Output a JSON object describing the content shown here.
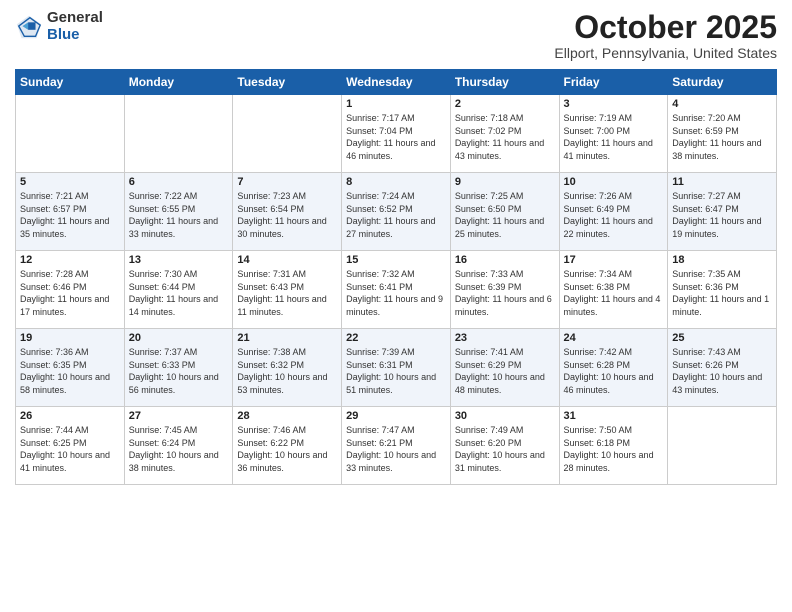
{
  "header": {
    "logo_general": "General",
    "logo_blue": "Blue",
    "month_title": "October 2025",
    "location": "Ellport, Pennsylvania, United States"
  },
  "days_of_week": [
    "Sunday",
    "Monday",
    "Tuesday",
    "Wednesday",
    "Thursday",
    "Friday",
    "Saturday"
  ],
  "weeks": [
    [
      {
        "day": "",
        "info": ""
      },
      {
        "day": "",
        "info": ""
      },
      {
        "day": "",
        "info": ""
      },
      {
        "day": "1",
        "info": "Sunrise: 7:17 AM\nSunset: 7:04 PM\nDaylight: 11 hours and 46 minutes."
      },
      {
        "day": "2",
        "info": "Sunrise: 7:18 AM\nSunset: 7:02 PM\nDaylight: 11 hours and 43 minutes."
      },
      {
        "day": "3",
        "info": "Sunrise: 7:19 AM\nSunset: 7:00 PM\nDaylight: 11 hours and 41 minutes."
      },
      {
        "day": "4",
        "info": "Sunrise: 7:20 AM\nSunset: 6:59 PM\nDaylight: 11 hours and 38 minutes."
      }
    ],
    [
      {
        "day": "5",
        "info": "Sunrise: 7:21 AM\nSunset: 6:57 PM\nDaylight: 11 hours and 35 minutes."
      },
      {
        "day": "6",
        "info": "Sunrise: 7:22 AM\nSunset: 6:55 PM\nDaylight: 11 hours and 33 minutes."
      },
      {
        "day": "7",
        "info": "Sunrise: 7:23 AM\nSunset: 6:54 PM\nDaylight: 11 hours and 30 minutes."
      },
      {
        "day": "8",
        "info": "Sunrise: 7:24 AM\nSunset: 6:52 PM\nDaylight: 11 hours and 27 minutes."
      },
      {
        "day": "9",
        "info": "Sunrise: 7:25 AM\nSunset: 6:50 PM\nDaylight: 11 hours and 25 minutes."
      },
      {
        "day": "10",
        "info": "Sunrise: 7:26 AM\nSunset: 6:49 PM\nDaylight: 11 hours and 22 minutes."
      },
      {
        "day": "11",
        "info": "Sunrise: 7:27 AM\nSunset: 6:47 PM\nDaylight: 11 hours and 19 minutes."
      }
    ],
    [
      {
        "day": "12",
        "info": "Sunrise: 7:28 AM\nSunset: 6:46 PM\nDaylight: 11 hours and 17 minutes."
      },
      {
        "day": "13",
        "info": "Sunrise: 7:30 AM\nSunset: 6:44 PM\nDaylight: 11 hours and 14 minutes."
      },
      {
        "day": "14",
        "info": "Sunrise: 7:31 AM\nSunset: 6:43 PM\nDaylight: 11 hours and 11 minutes."
      },
      {
        "day": "15",
        "info": "Sunrise: 7:32 AM\nSunset: 6:41 PM\nDaylight: 11 hours and 9 minutes."
      },
      {
        "day": "16",
        "info": "Sunrise: 7:33 AM\nSunset: 6:39 PM\nDaylight: 11 hours and 6 minutes."
      },
      {
        "day": "17",
        "info": "Sunrise: 7:34 AM\nSunset: 6:38 PM\nDaylight: 11 hours and 4 minutes."
      },
      {
        "day": "18",
        "info": "Sunrise: 7:35 AM\nSunset: 6:36 PM\nDaylight: 11 hours and 1 minute."
      }
    ],
    [
      {
        "day": "19",
        "info": "Sunrise: 7:36 AM\nSunset: 6:35 PM\nDaylight: 10 hours and 58 minutes."
      },
      {
        "day": "20",
        "info": "Sunrise: 7:37 AM\nSunset: 6:33 PM\nDaylight: 10 hours and 56 minutes."
      },
      {
        "day": "21",
        "info": "Sunrise: 7:38 AM\nSunset: 6:32 PM\nDaylight: 10 hours and 53 minutes."
      },
      {
        "day": "22",
        "info": "Sunrise: 7:39 AM\nSunset: 6:31 PM\nDaylight: 10 hours and 51 minutes."
      },
      {
        "day": "23",
        "info": "Sunrise: 7:41 AM\nSunset: 6:29 PM\nDaylight: 10 hours and 48 minutes."
      },
      {
        "day": "24",
        "info": "Sunrise: 7:42 AM\nSunset: 6:28 PM\nDaylight: 10 hours and 46 minutes."
      },
      {
        "day": "25",
        "info": "Sunrise: 7:43 AM\nSunset: 6:26 PM\nDaylight: 10 hours and 43 minutes."
      }
    ],
    [
      {
        "day": "26",
        "info": "Sunrise: 7:44 AM\nSunset: 6:25 PM\nDaylight: 10 hours and 41 minutes."
      },
      {
        "day": "27",
        "info": "Sunrise: 7:45 AM\nSunset: 6:24 PM\nDaylight: 10 hours and 38 minutes."
      },
      {
        "day": "28",
        "info": "Sunrise: 7:46 AM\nSunset: 6:22 PM\nDaylight: 10 hours and 36 minutes."
      },
      {
        "day": "29",
        "info": "Sunrise: 7:47 AM\nSunset: 6:21 PM\nDaylight: 10 hours and 33 minutes."
      },
      {
        "day": "30",
        "info": "Sunrise: 7:49 AM\nSunset: 6:20 PM\nDaylight: 10 hours and 31 minutes."
      },
      {
        "day": "31",
        "info": "Sunrise: 7:50 AM\nSunset: 6:18 PM\nDaylight: 10 hours and 28 minutes."
      },
      {
        "day": "",
        "info": ""
      }
    ]
  ]
}
